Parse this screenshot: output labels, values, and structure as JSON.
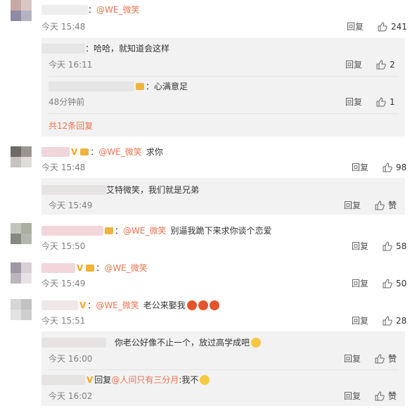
{
  "comments": [
    {
      "at": "@WE_微笑",
      "text": "",
      "time": "今天 15:48",
      "reply": "回复",
      "likes": "241"
    },
    {
      "at": "@WE_微笑",
      "text": "求你",
      "time": "今天 15:48",
      "reply": "回复",
      "likes": "98"
    },
    {
      "at": "@WE_微笑",
      "text": "别逼我跪下来求你谈个恋爱",
      "time": "今天 15:50",
      "reply": "回复",
      "likes": "58"
    },
    {
      "at": "@WE_微笑",
      "text": "",
      "time": "今天 15:49",
      "reply": "回复",
      "likes": "50"
    },
    {
      "at": "@WE_微笑",
      "text": "老公来娶我",
      "time": "今天 15:51",
      "reply": "回复",
      "likes": "28"
    }
  ],
  "subs": [
    {
      "text": "哈哈，就知道会这样",
      "time": "今天 16:11",
      "reply": "回复",
      "likes": "2"
    },
    {
      "text": "心满意足",
      "time": "48分钟前",
      "reply": "回复",
      "likes": "1"
    },
    {
      "text": "艾特微笑，我们就是兄弟",
      "time": "今天 15:49",
      "reply": "回复",
      "likes": "赞"
    },
    {
      "text": "你老公好像不止一个，放过高学成吧",
      "time": "今天 16:00",
      "reply": "回复",
      "likes": "赞"
    },
    {
      "prefix": "回复",
      "at": "@人间只有三分月",
      "text": ":我不",
      "time": "今天 16:02",
      "reply": "回复",
      "likes": "赞"
    }
  ],
  "more": "共12条回复",
  "colors": {
    "accent": "#eb7350",
    "subbg": "#f2f2f2"
  }
}
